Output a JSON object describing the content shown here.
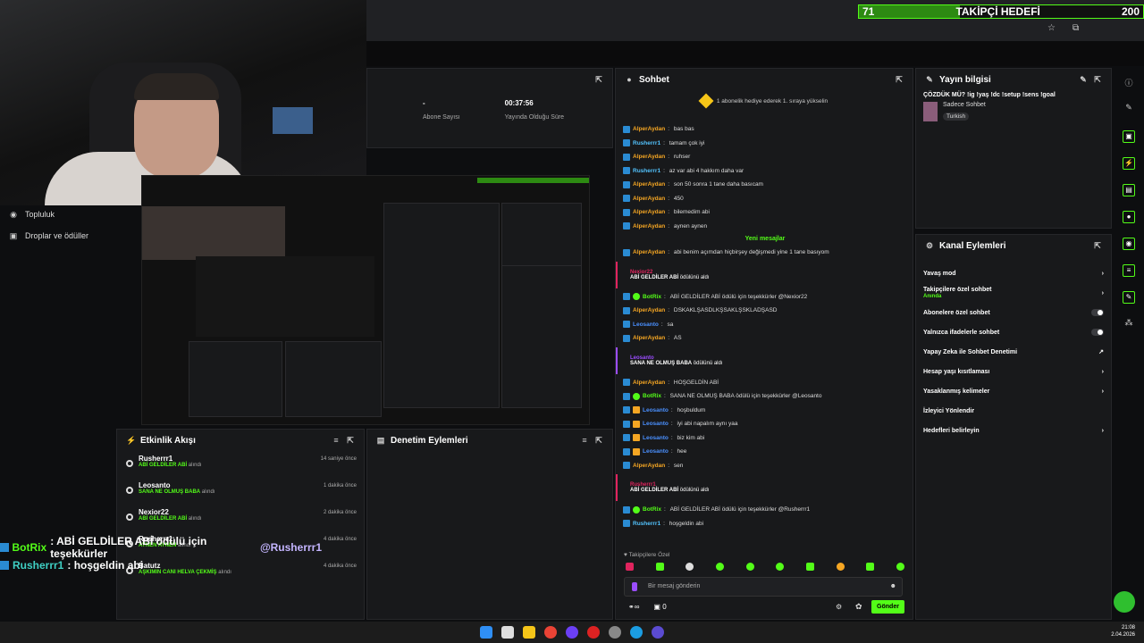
{
  "goal": {
    "current": "71",
    "label": "TAKİPÇİ HEDEFİ",
    "target": "200",
    "progress": 0.355
  },
  "leftnav": {
    "items": [
      {
        "label": "Topluluk"
      },
      {
        "label": "Droplar ve ödüller"
      }
    ]
  },
  "stats": {
    "subs_value": "-",
    "subs_label": "Abone Sayısı",
    "uptime_value": "00:37:56",
    "uptime_label": "Yayında Olduğu Süre"
  },
  "activity": {
    "title": "Etkinlik Akışı",
    "items": [
      {
        "user": "Rusherrr1",
        "reward": "ABİ GELDİLER ABİ",
        "suffix": "alındı",
        "time": "14 saniye önce"
      },
      {
        "user": "Leosanto",
        "reward": "SANA NE OLMUŞ BABA",
        "suffix": "alındı",
        "time": "1 dakika önce"
      },
      {
        "user": "Nexior22",
        "reward": "ABİ GELDİLER ABİ",
        "suffix": "alındı",
        "time": "2 dakika önce"
      },
      {
        "user": "Rusherrr1",
        "reward": "AYNEN AYNEN",
        "suffix": "alındı",
        "time": "4 dakika önce"
      },
      {
        "user": "Batutz",
        "reward": "AŞKIMIN CANI HELVA ÇEKMİŞ",
        "suffix": "alındı",
        "time": "4 dakika önce"
      }
    ]
  },
  "mod": {
    "title": "Denetim Eylemleri"
  },
  "overlay": [
    {
      "user": "BotRix",
      "text": ": ABİ GELDİLER ABİ ödülü için teşekkürler",
      "mention": "@Rusherrr1"
    },
    {
      "user": "Rusherrr1",
      "text": ": hoşgeldin abi",
      "mention": ""
    }
  ],
  "chat": {
    "title": "Sohbet",
    "pinned": "1 abonelik hediye ederek 1. sıraya yükselin",
    "new_messages": "Yeni mesajlar",
    "messages_before": [
      {
        "user": "AlperAydan",
        "color": "#f5a623",
        "text": "bas bas"
      },
      {
        "user": "Rusherrr1",
        "color": "#53c4ff",
        "text": "tamam çok iyi"
      },
      {
        "user": "AlperAydan",
        "color": "#f5a623",
        "text": "ruhser"
      },
      {
        "user": "Rusherrr1",
        "color": "#53c4ff",
        "text": "az var abi 4 hakkım daha var"
      },
      {
        "user": "AlperAydan",
        "color": "#f5a623",
        "text": "son 50 sonra 1 tane daha basıcam"
      },
      {
        "user": "AlperAydan",
        "color": "#f5a623",
        "text": "450"
      },
      {
        "user": "AlperAydan",
        "color": "#f5a623",
        "text": "bilemedim abi"
      },
      {
        "user": "AlperAydan",
        "color": "#f5a623",
        "text": "aynen aynen"
      }
    ],
    "m1": {
      "user": "AlperAydan",
      "text": "abi benim açımdan hiçbirşey değişmedi yine 1 tane basıyom"
    },
    "g1": {
      "user": "Nexior22",
      "reward": "ABİ GELDİLER ABİ",
      "suffix": "ödülünü aldı"
    },
    "m2": {
      "user": "BotRix",
      "text": "ABİ GELDİLER ABİ ödülü için teşekkürler @Nexior22"
    },
    "m3": {
      "user": "AlperAydan",
      "text": "DSKAKLŞASDLKŞSAKLŞSKLADŞASD"
    },
    "m4": {
      "user": "Leosanto",
      "text": "sa"
    },
    "m5": {
      "user": "AlperAydan",
      "text": "AS"
    },
    "g2": {
      "user": "Leosanto",
      "reward": "SANA NE OLMUŞ BABA",
      "suffix": "ödülünü aldı"
    },
    "m6": {
      "user": "AlperAydan",
      "text": "HOŞGELDİN ABİ"
    },
    "m7": {
      "user": "BotRix",
      "text": "SANA NE OLMUŞ BABA ödülü için teşekkürler @Leosanto"
    },
    "m8": {
      "user": "Leosanto",
      "text": "hoşbuldum"
    },
    "m9": {
      "user": "Leosanto",
      "text": "iyi abi napalım aynı yaa"
    },
    "m10": {
      "user": "Leosanto",
      "text": "biz kim abi"
    },
    "m11": {
      "user": "Leosanto",
      "text": "hee"
    },
    "m12": {
      "user": "AlperAydan",
      "text": "sen"
    },
    "g3": {
      "user": "Rusherrr1",
      "reward": "ABİ GELDİLER ABİ",
      "suffix": "ödülünü aldı"
    },
    "m13": {
      "user": "BotRix",
      "text": "ABİ GELDİLER ABİ ödülü için teşekkürler @Rusherrr1"
    },
    "m14": {
      "user": "Rusherrr1",
      "text": "hoşgeldin abi"
    },
    "followers_only": "Takipçilere Özel",
    "input_placeholder": "Bir mesaj gönderin",
    "count": "0",
    "send": "Gönder"
  },
  "streaminfo": {
    "title": "Yayın bilgisi",
    "stream_title": "ÇÖZDÜK MÜ? !ig !yaş !dc !setup !sens !goal",
    "category": "Sadece Sohbet",
    "tag": "Turkish"
  },
  "channel_actions": {
    "title": "Kanal Eylemleri",
    "items": [
      {
        "label": "Yavaş mod",
        "sub": ""
      },
      {
        "label": "Takipçilere özel sohbet",
        "sub": "Anında"
      },
      {
        "label": "Abonelere özel sohbet",
        "sub": ""
      },
      {
        "label": "Yalnızca ifadelerle sohbet",
        "sub": ""
      },
      {
        "label": "Yapay Zeka ile Sohbet Denetimi",
        "sub": ""
      },
      {
        "label": "Hesap yaşı kısıtlaması",
        "sub": ""
      },
      {
        "label": "Yasaklanmış kelimeler",
        "sub": ""
      },
      {
        "label": "İzleyici Yönlendir",
        "sub": ""
      },
      {
        "label": "Hedefleri belirleyin",
        "sub": ""
      }
    ]
  },
  "clock": {
    "time": "21:08",
    "date": "2.04.2026"
  },
  "colors": {
    "accent": "#53fc18",
    "alper": "#f5a623",
    "blue_user": "#53c4ff",
    "leosanto": "#4a90ff",
    "red_gift": "#e0245e",
    "purple_gift": "#9b4dff"
  }
}
